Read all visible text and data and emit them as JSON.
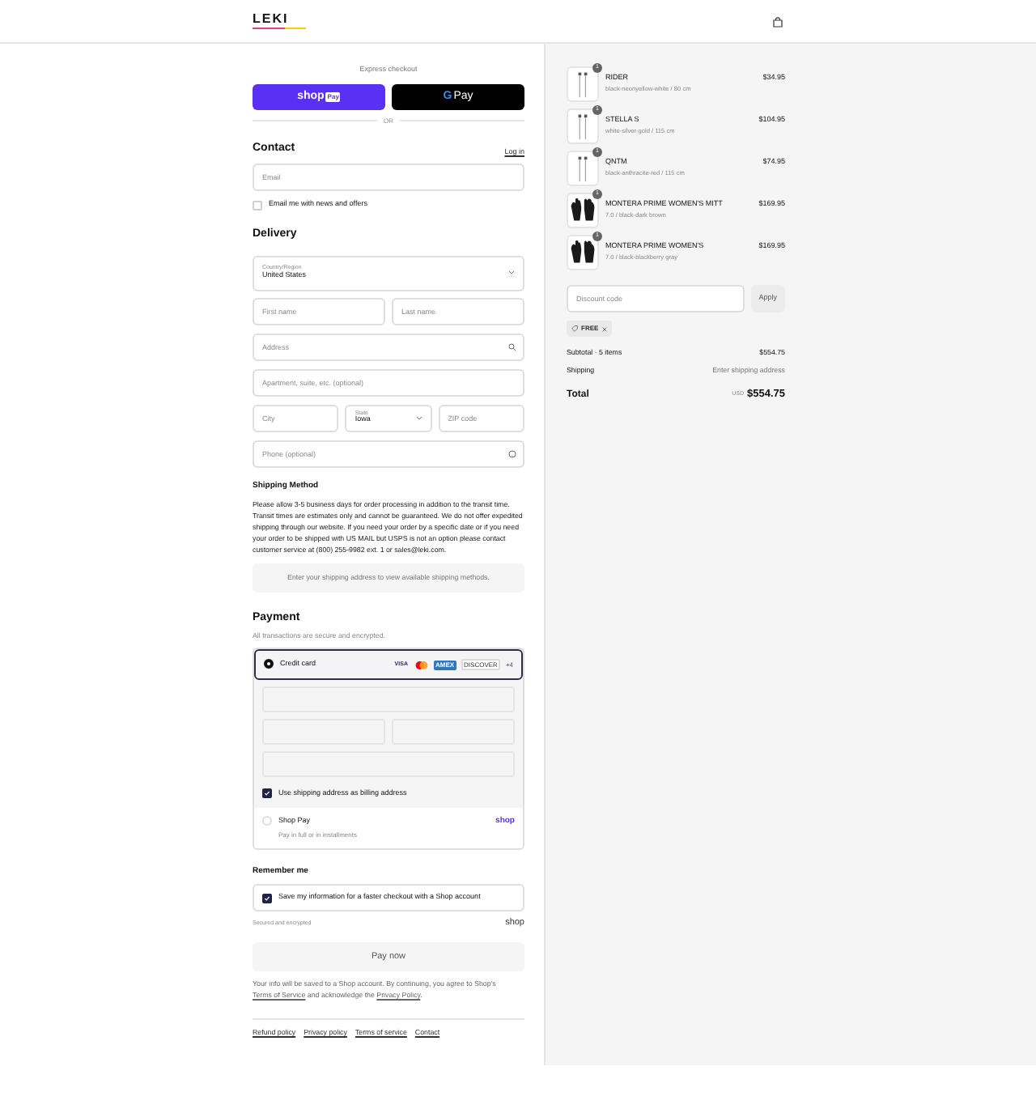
{
  "header": {
    "logo": "LEKI"
  },
  "express": {
    "label": "Express checkout",
    "shop_pay": "shop",
    "shop_pay_tag": "Pay",
    "gpay": "Pay",
    "gpay_g": "G",
    "or": "OR"
  },
  "contact": {
    "title": "Contact",
    "login": "Log in",
    "email": {
      "placeholder": "Email"
    },
    "newsletter": {
      "label": "Email me with news and offers",
      "checked": false
    }
  },
  "delivery": {
    "title": "Delivery",
    "country": {
      "label": "Country/Region",
      "value": "United States"
    },
    "first_name": {
      "placeholder": "First name"
    },
    "last_name": {
      "placeholder": "Last name"
    },
    "address": {
      "placeholder": "Address"
    },
    "apartment": {
      "placeholder": "Apartment, suite, etc. (optional)"
    },
    "city": {
      "placeholder": "City"
    },
    "state": {
      "label": "State",
      "value": "Iowa"
    },
    "zip": {
      "placeholder": "ZIP code"
    },
    "phone": {
      "placeholder": "Phone (optional)"
    }
  },
  "shipping_method": {
    "title": "Shipping Method",
    "text": "Please allow 3-5 business days for order processing in addition to the transit time. Transit times are estimates only and cannot be guaranteed. We do not offer expedited shipping through our website. If you need your order by a specific date or if you need your order to be shipped with US MAIL but USPS is not an option please contact customer service at (800) 255-9982 ext. 1 or sales@leki.com.",
    "notice": "Enter your shipping address to view available shipping methods."
  },
  "payment": {
    "title": "Payment",
    "subtitle": "All transactions are secure and encrypted.",
    "methods": [
      {
        "label": "Credit card",
        "selected": true,
        "cards": [
          {
            "kind": "visa",
            "label": "VISA"
          },
          {
            "kind": "mastercard"
          },
          {
            "kind": "amex",
            "label": "AMEX"
          },
          {
            "kind": "discover",
            "label": "DISCOVER"
          }
        ],
        "more": "+4"
      },
      {
        "label": "Shop Pay",
        "sublabel": "Pay in full or in installments",
        "selected": false,
        "brand": "shop"
      }
    ],
    "billing_same": {
      "label": "Use shipping address as billing address",
      "checked": true
    }
  },
  "remember": {
    "title": "Remember me",
    "save": {
      "label": "Save my information for a faster checkout with a Shop account",
      "checked": true
    },
    "secure": "Secured and encrypted",
    "brand": "shop"
  },
  "pay_button": "Pay now",
  "legal": {
    "text": "Your info will be saved to a Shop account. By continuing, you agree to Shop's ",
    "terms": "Terms of Service",
    "middle": " and acknowledge the ",
    "privacy": "Privacy Policy",
    "end": "."
  },
  "footer_links": [
    "Refund policy",
    "Privacy policy",
    "Terms of service",
    "Contact"
  ],
  "cart": {
    "items": [
      {
        "name": "RIDER",
        "variant": "black-neonyellow-white / 80 cm",
        "price": "$34.95",
        "quantity": "1",
        "kind": "pole"
      },
      {
        "name": "STELLA S",
        "variant": "white-silver-gold / 115 cm",
        "price": "$104.95",
        "quantity": "1",
        "kind": "pole"
      },
      {
        "name": "QNTM",
        "variant": "black-anthracite-red / 115 cm",
        "price": "$74.95",
        "quantity": "1",
        "kind": "pole"
      },
      {
        "name": "MONTERA PRIME WOMEN'S MITT",
        "variant": "7.0 / black-dark brown",
        "price": "$169.95",
        "quantity": "1",
        "kind": "glove"
      },
      {
        "name": "MONTERA PRIME WOMEN'S",
        "variant": "7.0 / black-blackberry gray",
        "price": "$169.95",
        "quantity": "1",
        "kind": "glove"
      }
    ],
    "discount": {
      "placeholder": "Discount code",
      "apply": "Apply"
    },
    "tag": "FREE",
    "subtotal_label": "Subtotal · 5 items",
    "subtotal": "$554.75",
    "shipping_label": "Shipping",
    "shipping": "Enter shipping address",
    "total_label": "Total",
    "currency": "USD",
    "total": "$554.75"
  }
}
